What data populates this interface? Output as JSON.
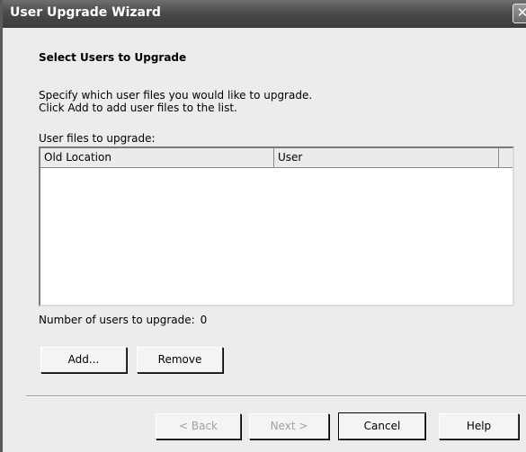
{
  "window": {
    "title": "User Upgrade Wizard",
    "close_glyph": "✕"
  },
  "page": {
    "heading": "Select Users to Upgrade",
    "description_line1": "Specify which user files you would like to upgrade.",
    "description_line2": "Click Add to add user files to the list.",
    "list_label": "User files to upgrade:",
    "columns": [
      "Old Location",
      "User"
    ],
    "rows": [],
    "count_label": "Number of users to upgrade:",
    "count_value": "0"
  },
  "actions": {
    "add_label": "Add...",
    "remove_label": "Remove"
  },
  "footer": {
    "back_label": "< Back",
    "next_label": "Next >",
    "cancel_label": "Cancel",
    "help_label": "Help"
  },
  "colors": {
    "titlebar": "#4b4b4b",
    "dialog_background": "#ececec",
    "disabled_text": "#a0a0a0"
  }
}
